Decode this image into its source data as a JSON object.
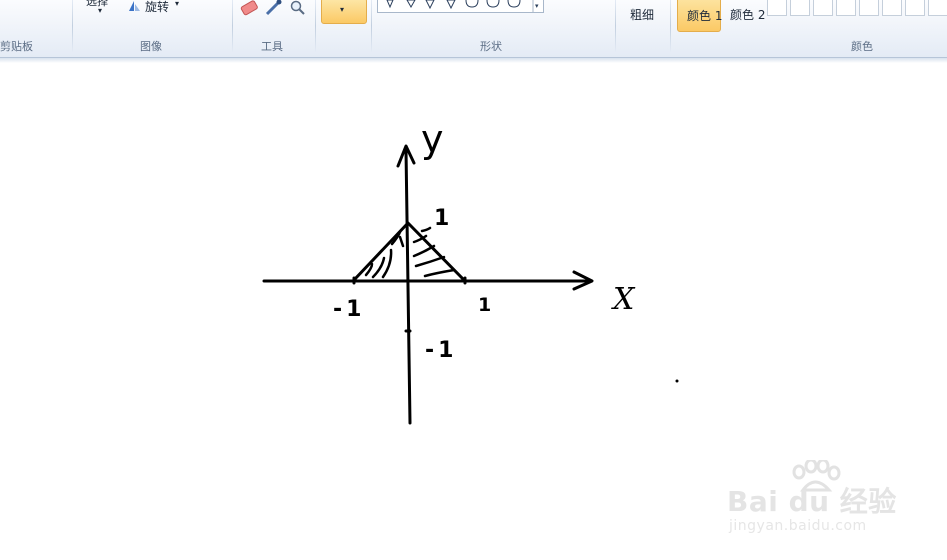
{
  "ribbon": {
    "clipboard": {
      "label": "剪贴板"
    },
    "image": {
      "label": "图像",
      "select_label": "选择",
      "rotate_label": "旋转"
    },
    "tools": {
      "label": "工具"
    },
    "shapes": {
      "label": "形状"
    },
    "size": {
      "label": "粗细"
    },
    "colors": {
      "label": "颜色",
      "color1": "颜色 1",
      "color2": "颜色 2"
    }
  },
  "canvas": {
    "x_axis_label": "X",
    "y_axis_label": "y",
    "tick_y_pos": "1",
    "tick_y_neg": "-1",
    "tick_x_pos": "1",
    "tick_x_neg": "-1"
  },
  "watermark": {
    "brand": "Bai du 经验",
    "url": "jingyan.baidu.com"
  },
  "colors": {
    "accent": "#fbc965",
    "ribbon_bg": "#e4ebf5",
    "ink": "#000000"
  }
}
